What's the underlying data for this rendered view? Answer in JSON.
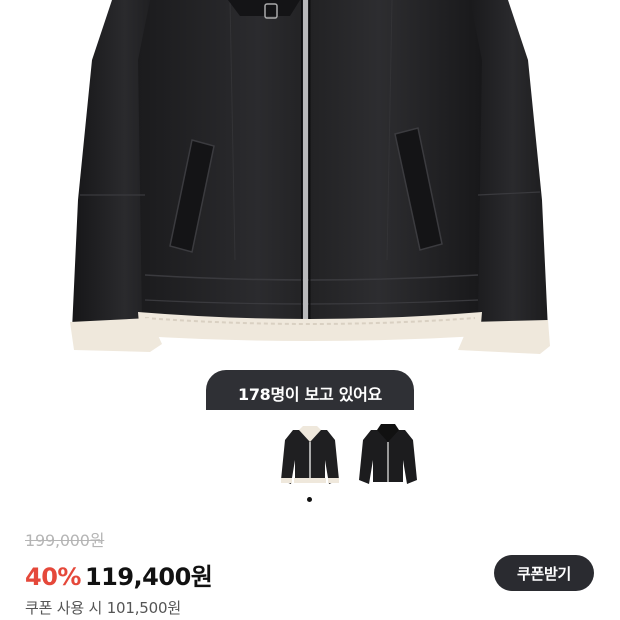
{
  "product": {
    "viewers_text": "178명이 보고 있어요",
    "original_price": "199,000원",
    "discount_rate": "40%",
    "sale_price": "119,400원",
    "coupon_price_text": "쿠폰 사용 시 101,500원",
    "coupon_button_label": "쿠폰받기"
  },
  "gallery": {
    "thumbnails": [
      "shearling-jacket-front",
      "shearling-jacket-collar-up"
    ],
    "active_index": 0
  },
  "colors": {
    "discount": "#e5483a",
    "button_bg": "#2a2b30",
    "pill_bg": "#2f3035"
  }
}
